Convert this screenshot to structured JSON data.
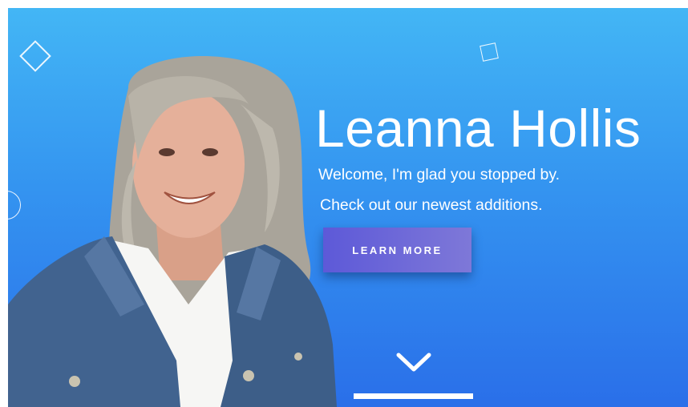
{
  "hero": {
    "title": "Leanna Hollis",
    "subtitle_line1": "Welcome, I'm glad you stopped by.",
    "subtitle_line2": "Check out our newest additions.",
    "cta_label": "LEARN MORE",
    "scroll_icon": "chevron-down-icon"
  },
  "colors": {
    "gradient_top": "#43b6f5",
    "gradient_bottom": "#2a6fe9",
    "button_start": "#5d59d8",
    "button_end": "#7e78d8",
    "text": "#ffffff"
  }
}
